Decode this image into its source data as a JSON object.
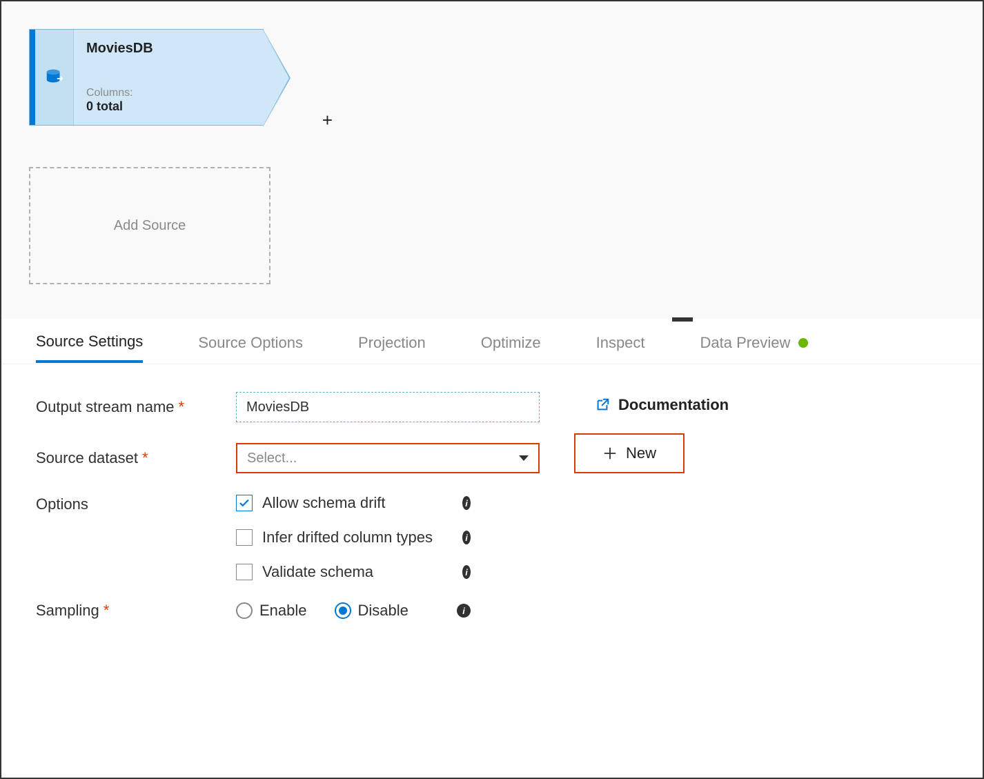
{
  "node": {
    "title": "MoviesDB",
    "columns_label": "Columns:",
    "columns_count": "0 total",
    "plus": "+"
  },
  "add_source_label": "Add Source",
  "tabs": [
    {
      "label": "Source Settings",
      "active": true
    },
    {
      "label": "Source Options",
      "active": false
    },
    {
      "label": "Projection",
      "active": false
    },
    {
      "label": "Optimize",
      "active": false
    },
    {
      "label": "Inspect",
      "active": false
    },
    {
      "label": "Data Preview",
      "active": false,
      "status": true
    }
  ],
  "form": {
    "output_stream_label": "Output stream name",
    "output_stream_value": "MoviesDB",
    "source_dataset_label": "Source dataset",
    "source_dataset_placeholder": "Select...",
    "options_label": "Options",
    "options": {
      "allow_schema_drift": "Allow schema drift",
      "infer_drifted": "Infer drifted column types",
      "validate_schema": "Validate schema"
    },
    "sampling_label": "Sampling",
    "sampling_enable": "Enable",
    "sampling_disable": "Disable"
  },
  "links": {
    "documentation": "Documentation",
    "new": "New"
  }
}
